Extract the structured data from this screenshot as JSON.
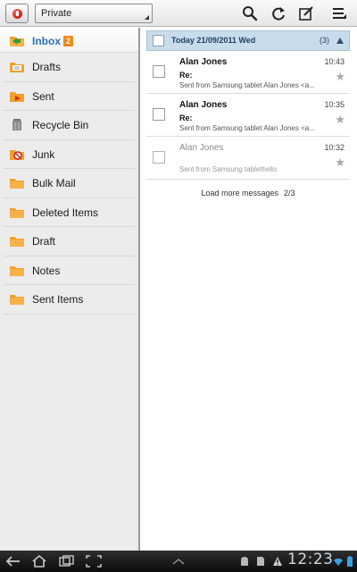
{
  "toolbar": {
    "account": "Private",
    "icons": [
      "search-icon",
      "refresh-icon",
      "compose-icon",
      "menu-icon"
    ]
  },
  "sidebar": {
    "folders": [
      {
        "label": "Inbox",
        "icon": "inbox-folder-icon",
        "badge": "2",
        "active": true
      },
      {
        "label": "Drafts",
        "icon": "drafts-folder-icon"
      },
      {
        "label": "Sent",
        "icon": "sent-folder-icon"
      },
      {
        "label": "Recycle Bin",
        "icon": "trash-icon"
      },
      {
        "label": "Junk",
        "icon": "junk-folder-icon"
      },
      {
        "label": "Bulk Mail",
        "icon": "folder-icon"
      },
      {
        "label": "Deleted Items",
        "icon": "folder-icon"
      },
      {
        "label": "Draft",
        "icon": "folder-icon"
      },
      {
        "label": "Notes",
        "icon": "folder-icon"
      },
      {
        "label": "Sent Items",
        "icon": "folder-icon"
      }
    ]
  },
  "list": {
    "group_label": "Today  21/09/2011 Wed",
    "group_count": "(3)",
    "messages": [
      {
        "sender": "Alan Jones",
        "time": "10:43",
        "subject": "Re:",
        "preview": "Sent from Samsung tablet Alan Jones <a...",
        "read": false
      },
      {
        "sender": "Alan Jones",
        "time": "10:35",
        "subject": "Re:",
        "preview": "Sent from Samsung tablet Alan Jones <a...",
        "read": false
      },
      {
        "sender": "Alan Jones",
        "time": "10:32",
        "subject": "",
        "preview": "Sent from Samsung tablethello",
        "read": true
      }
    ],
    "load_more": "Load more messages",
    "page": "2/3"
  },
  "system_bar": {
    "clock": "12:23",
    "colors": {
      "bar": "#111111",
      "clock": "#cfd7de"
    }
  },
  "colors": {
    "accent": "#2a6fb8",
    "badge": "#f08a1c",
    "folder": "#f0a030",
    "header": "#c9dcec"
  }
}
